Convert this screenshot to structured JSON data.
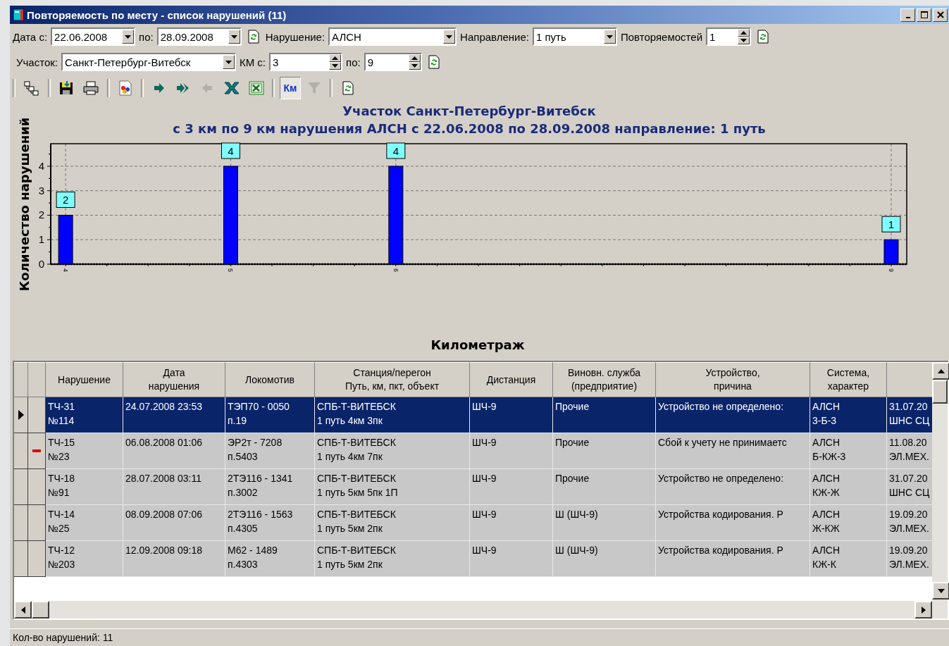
{
  "window": {
    "title": "Повторяемость по месту - список нарушений (11)"
  },
  "filters": [
    [
      {
        "kind": "label",
        "text": "Дата с:"
      },
      {
        "kind": "combo",
        "value": "22.06.2008"
      },
      {
        "kind": "label",
        "text": "по:"
      },
      {
        "kind": "combo",
        "value": "28.09.2008"
      },
      {
        "kind": "refresh"
      },
      {
        "kind": "label",
        "text": "Нарушение:"
      },
      {
        "kind": "combo",
        "value": "АЛСН"
      },
      {
        "kind": "label",
        "text": "Направление:"
      },
      {
        "kind": "combo",
        "value": "1 путь"
      },
      {
        "kind": "label",
        "text": "Повторяемостей"
      },
      {
        "kind": "spin",
        "value": "1"
      },
      {
        "kind": "refresh"
      }
    ],
    [
      {
        "kind": "label",
        "text": "Участок:"
      },
      {
        "kind": "combo",
        "value": "Санкт-Петербург-Витебск"
      },
      {
        "kind": "label",
        "text": "КМ с:"
      },
      {
        "kind": "spin",
        "value": "3"
      },
      {
        "kind": "label",
        "text": "по:"
      },
      {
        "kind": "spin",
        "value": "9"
      },
      {
        "kind": "refresh"
      }
    ]
  ],
  "toolbar": [
    [
      {
        "kind": "tree",
        "disabled": false,
        "pressed": false
      }
    ],
    [
      {
        "kind": "save",
        "disabled": false,
        "pressed": false
      },
      {
        "kind": "print",
        "disabled": false,
        "pressed": false
      }
    ],
    [
      {
        "kind": "report",
        "disabled": false,
        "pressed": false
      }
    ],
    [
      {
        "kind": "next",
        "disabled": false,
        "pressed": false
      },
      {
        "kind": "last",
        "disabled": false,
        "pressed": false
      },
      {
        "kind": "prev",
        "disabled": true,
        "pressed": false
      },
      {
        "kind": "cross",
        "disabled": false,
        "pressed": false
      },
      {
        "kind": "sheet",
        "disabled": false,
        "pressed": false
      }
    ],
    [
      {
        "kind": "text",
        "label": "Км",
        "disabled": false,
        "pressed": true
      },
      {
        "kind": "filter",
        "disabled": true,
        "pressed": false
      }
    ],
    [
      {
        "kind": "refresh",
        "disabled": false,
        "pressed": false
      }
    ]
  ],
  "chart": {
    "chart_data": {
      "type": "bar",
      "title": "Участок Санкт-Петербург-Витебск\nс 3 км по 9 км нарушения АЛСН с 22.06.2008 по 28.09.2008 направление: 1 путь",
      "annotations": [
        {
          "text": "Километраж"
        }
      ],
      "ylabel": "Количество нарушений",
      "x": [
        4,
        5,
        6,
        9
      ],
      "series": [
        {
          "color": "#0000ff",
          "values": [
            2,
            4,
            4,
            1
          ]
        }
      ],
      "xlim": [
        3.91,
        9.094
      ],
      "ylim": [
        0,
        4.92
      ],
      "xticks": [
        4,
        5,
        6,
        9
      ],
      "yticks": [
        0,
        1,
        2,
        3,
        4
      ],
      "data_labels": true,
      "grid": true
    }
  },
  "table": {
    "columns": [
      "Нарушение",
      "Дата\nнарушения",
      "Локомотив",
      "Станция/перегон\nПуть, км, пкт, объект",
      "Дистанция",
      "Виновн. служба\n(предприятие)",
      "Устройство,\nпричина",
      "Система,\nхарактер"
    ],
    "rows": [
      {
        "selected": true,
        "flagged": false,
        "cells": [
          "ТЧ-31\n№114",
          "24.07.2008 23:53",
          "ТЭП70 - 0050\nп.19",
          "СПБ-Т-ВИТЕБСК\n1 путь 4км 3пк",
          "ШЧ-9",
          "Прочие",
          "Устройство не определено:",
          "АЛСН\n3-Б-3",
          "31.07.20\nШНС СЦ"
        ]
      },
      {
        "selected": false,
        "flagged": true,
        "cells": [
          "ТЧ-15\n№23",
          "06.08.2008 01:06",
          "ЭР2т - 7208\nп.5403",
          "СПБ-Т-ВИТЕБСК\n1 путь 4км 7пк",
          "ШЧ-9",
          "Прочие",
          "Сбой к учету не принимаетс",
          "АЛСН\nБ-КЖ-3",
          "11.08.20\nЭЛ.МЕХ."
        ]
      },
      {
        "selected": false,
        "flagged": false,
        "cells": [
          "ТЧ-18\n№91",
          "28.07.2008 03:11",
          "2ТЭ116 - 1341\nп.3002",
          "СПБ-Т-ВИТЕБСК\n1 путь 5км 5пк 1П",
          "ШЧ-9",
          "Прочие",
          "Устройство не определено:",
          "АЛСН\nКЖ-Ж",
          "31.07.20\nШНС СЦ"
        ]
      },
      {
        "selected": false,
        "flagged": false,
        "cells": [
          "ТЧ-14\n№25",
          "08.09.2008 07:06",
          "2ТЭ116 - 1563\nп.4305",
          "СПБ-Т-ВИТЕБСК\n1 путь 5км 2пк",
          "ШЧ-9",
          "Ш (ШЧ-9)",
          "Устройства кодирования. Р",
          "АЛСН\nЖ-КЖ",
          "19.09.20\nЭЛ.МЕХ."
        ]
      },
      {
        "selected": false,
        "flagged": false,
        "cells": [
          "ТЧ-12\n№203",
          "12.09.2008 09:18",
          "М62 - 1489\nп.4303",
          "СПБ-Т-ВИТЕБСК\n1 путь 5км 2пк",
          "ШЧ-9",
          "Ш (ШЧ-9)",
          "Устройства кодирования. Р",
          "АЛСН\nКЖ-К",
          "19.09.20\nЭЛ.МЕХ."
        ]
      }
    ]
  },
  "status_bar": {
    "text": "Кол-во нарушений: 11"
  }
}
